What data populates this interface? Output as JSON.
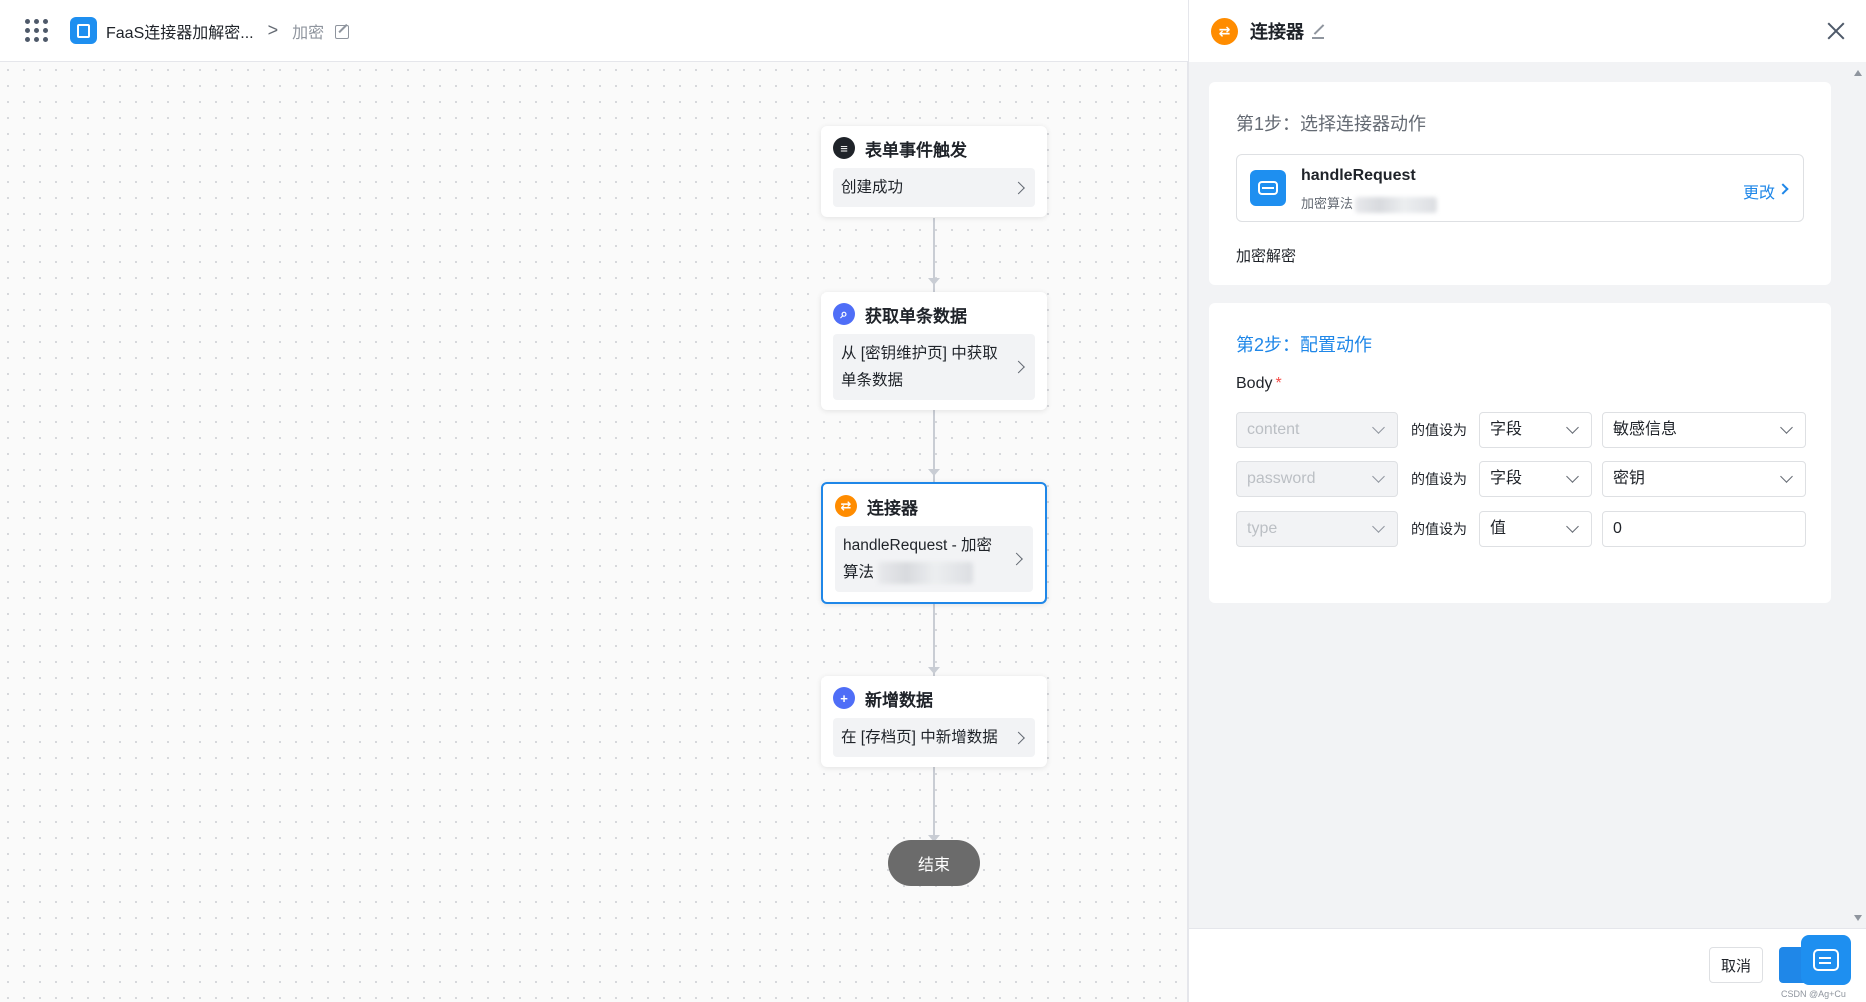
{
  "header": {
    "app_title": "FaaS连接器加解密...",
    "breadcrumb_separator": ">",
    "page_name": "加密"
  },
  "flow": {
    "nodes": [
      {
        "title": "表单事件触发",
        "body": "创建成功",
        "icon": "document-icon",
        "icon_color": "#1f2329"
      },
      {
        "title": "获取单条数据",
        "body_line1": "从 [密钥维护页] 中获取",
        "body_line2": "单条数据",
        "icon": "search-icon",
        "icon_color": "#4f6ef7"
      },
      {
        "title": "连接器",
        "body_line1": "handleRequest - 加密",
        "body_line2": "算法",
        "icon": "connector-icon",
        "icon_color": "#ff8c00"
      },
      {
        "title": "新增数据",
        "body": "在 [存档页] 中新增数据",
        "icon": "plus-icon",
        "icon_color": "#4f6ef7"
      }
    ],
    "end_label": "结束"
  },
  "panel": {
    "title": "连接器",
    "step1": {
      "label": "第1步：选择连接器动作",
      "action_name": "handleRequest",
      "action_sub": "加密算法",
      "change_label": "更改",
      "description": "加密解密"
    },
    "step2": {
      "label": "第2步：配置动作",
      "field_label": "Body",
      "required_mark": "*",
      "rows": [
        {
          "key": "content",
          "set_as": "的值设为",
          "type": "字段",
          "value": "敏感信息"
        },
        {
          "key": "password",
          "set_as": "的值设为",
          "type": "字段",
          "value": "密钥"
        },
        {
          "key": "type",
          "set_as": "的值设为",
          "type": "值",
          "value": "0"
        }
      ]
    },
    "footer": {
      "cancel_label": "取消",
      "confirm_label": "确",
      "watermark": "CSDN @Ag+Cu"
    }
  },
  "colors": {
    "accent": "#1f87e8",
    "connector": "#ff8c00",
    "end_node": "#6b6b6b"
  }
}
